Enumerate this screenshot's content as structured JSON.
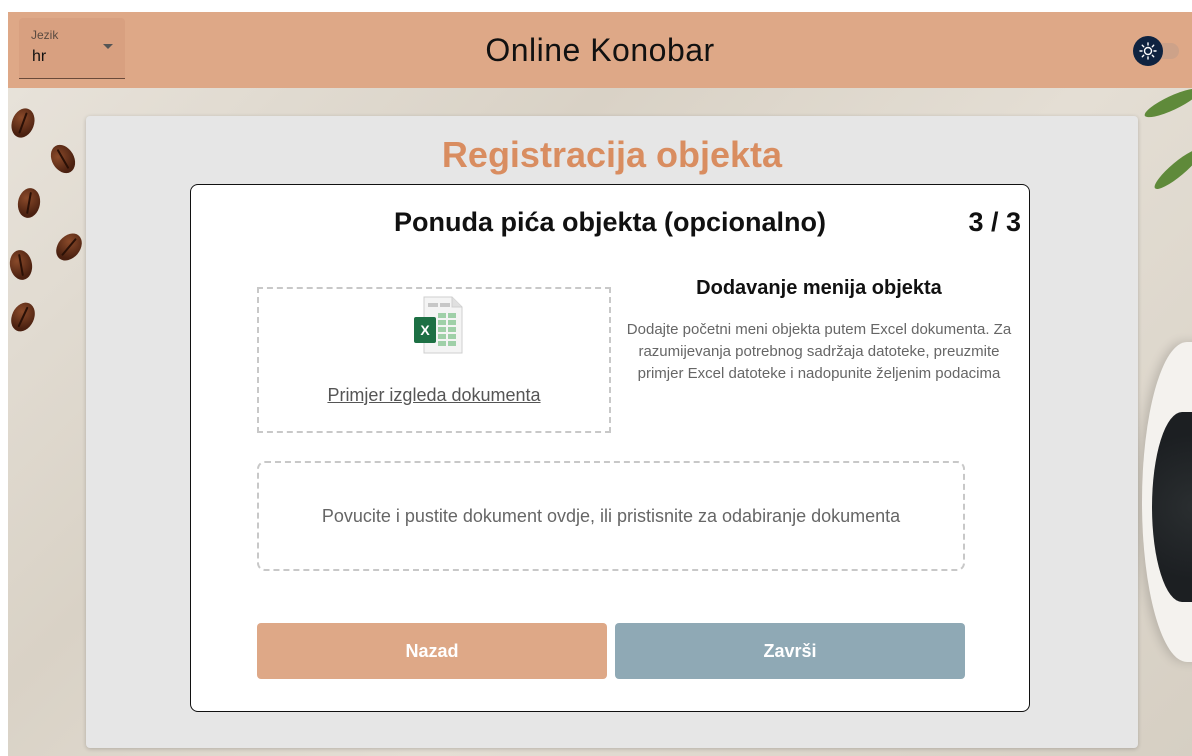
{
  "header": {
    "title": "Online Konobar",
    "language": {
      "label": "Jezik",
      "value": "hr"
    },
    "theme_toggle_icon": "sun-icon"
  },
  "card": {
    "title": "Registracija objekta",
    "step": {
      "title": "Ponuda pića objekta (opcionalno)",
      "counter": "3 / 3"
    },
    "example": {
      "icon": "excel-icon",
      "link_text": "Primjer izgleda dokumenta"
    },
    "info": {
      "heading": "Dodavanje menija objekta",
      "text": "Dodajte početni meni objekta putem Excel dokumenta. Za razumijevanja potrebnog sadržaja datoteke, preuzmite primjer Excel datoteke i nadopunite željenim podacima"
    },
    "dropzone_text": "Povucite i pustite dokument ovdje, ili pristisnite za odabiranje dokumenta",
    "buttons": {
      "back": "Nazad",
      "finish": "Završi"
    }
  },
  "colors": {
    "accent": "#dea887",
    "title": "#d98d60",
    "finish_button": "#8fa9b5",
    "excel_green": "#1d7044"
  }
}
